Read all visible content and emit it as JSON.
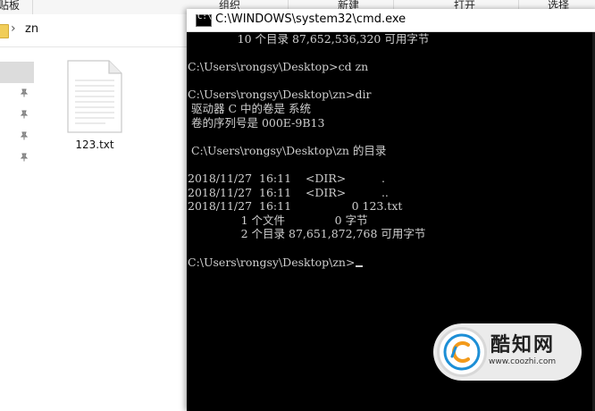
{
  "explorer": {
    "ribbon": {
      "labels": [
        "贴板",
        "组织",
        "新建",
        "打开",
        "选择"
      ]
    },
    "address": {
      "path": "zn"
    },
    "file": {
      "name": "123.txt"
    }
  },
  "cmd": {
    "title": "C:\\WINDOWS\\system32\\cmd.exe",
    "lines": [
      "              10 个目录 87,652,536,320 可用字节",
      "",
      "C:\\Users\\rongsy\\Desktop>cd zn",
      "",
      "C:\\Users\\rongsy\\Desktop\\zn>dir",
      " 驱动器 C 中的卷是 系统",
      " 卷的序列号是 000E-9B13",
      "",
      " C:\\Users\\rongsy\\Desktop\\zn 的目录",
      "",
      "2018/11/27  16:11    <DIR>          .",
      "2018/11/27  16:11    <DIR>          ..",
      "2018/11/27  16:11                 0 123.txt",
      "               1 个文件              0 字节",
      "               2 个目录 87,651,872,768 可用字节",
      "",
      "C:\\Users\\rongsy\\Desktop\\zn>"
    ]
  },
  "watermark": {
    "brand": "酷知网",
    "url": "www.coozhi.com"
  }
}
